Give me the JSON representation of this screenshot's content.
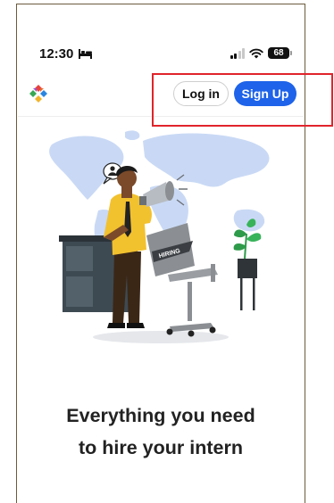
{
  "status_bar": {
    "time": "12:30",
    "battery_level": "68",
    "icons": [
      "bed-icon",
      "cellular-signal-icon",
      "wifi-icon",
      "battery-icon"
    ]
  },
  "header": {
    "logo": "app-logo-icon",
    "login_label": "Log in",
    "signup_label": "Sign Up"
  },
  "illustration": {
    "sign_text": "HIRING"
  },
  "hero": {
    "headline_line1": "Everything you need",
    "headline_line2": "to hire your intern"
  },
  "colors": {
    "accent": "#1e63e9",
    "highlight": "#e0242b",
    "shirt": "#f2c12e",
    "plant": "#2e9b4a",
    "map": "#c9d9f5"
  }
}
